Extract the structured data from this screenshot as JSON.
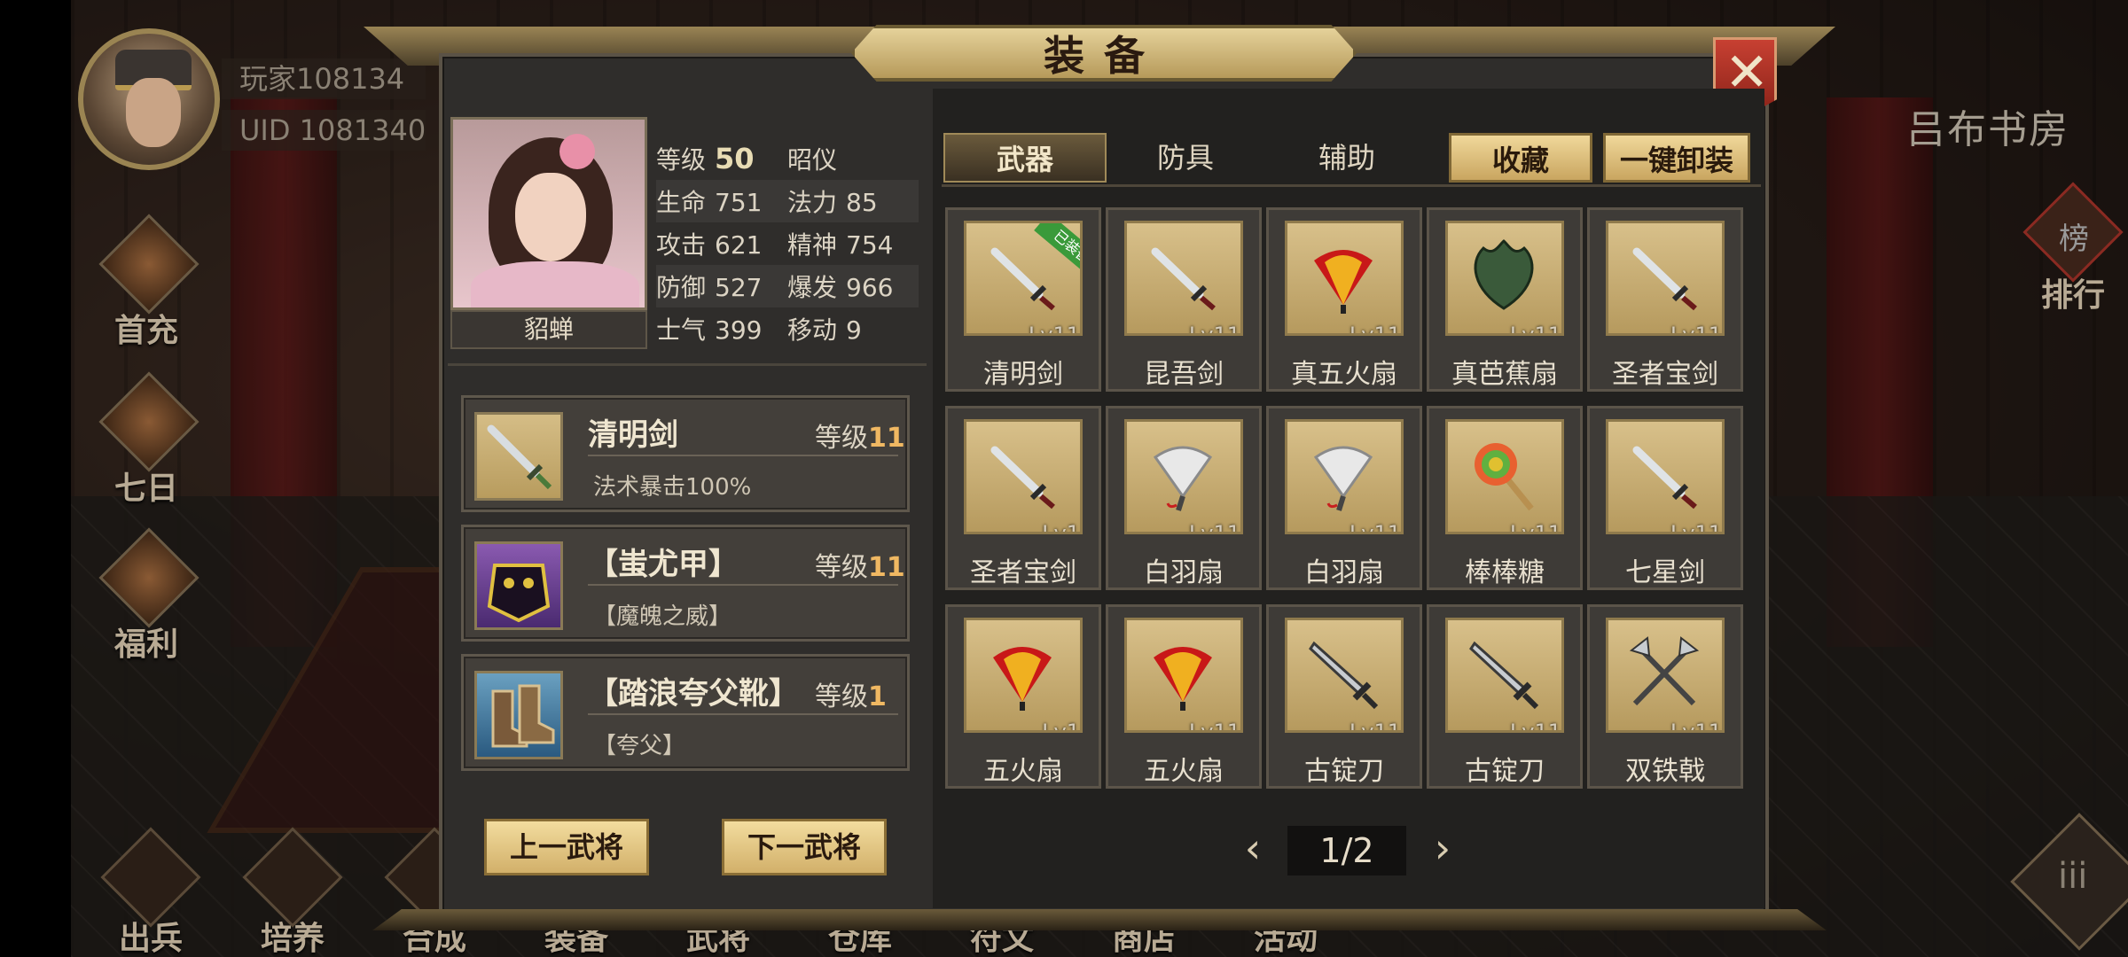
{
  "hud": {
    "player_name": "玩家108134",
    "player_uid": "UID  1081340",
    "room_title": "吕布书房",
    "side_buttons": [
      {
        "label": "首充",
        "icon": "gift-box-icon"
      },
      {
        "label": "七日",
        "icon": "scroll-icon"
      },
      {
        "label": "福利",
        "icon": "treasure-icon"
      }
    ],
    "rank_label": "排行",
    "rank_icon_text": "榜",
    "bottom_nav": [
      {
        "label": "出兵",
        "icon": "drum-icon"
      },
      {
        "label": "培养",
        "icon": "spear-icon"
      },
      {
        "label": "合成",
        "icon": "anvil-icon"
      },
      {
        "label": "装备",
        "icon": "armor-icon"
      },
      {
        "label": "武将",
        "icon": "general-icon"
      },
      {
        "label": "仓库",
        "icon": "chest-icon"
      },
      {
        "label": "符文",
        "icon": "rune-icon"
      },
      {
        "label": "商店",
        "icon": "shop-icon"
      },
      {
        "label": "活动",
        "icon": "flag-icon"
      }
    ],
    "menu_icon": "iii"
  },
  "modal": {
    "title": "装备",
    "close_icon": "✕"
  },
  "hero": {
    "name": "貂蝉",
    "level_label": "等级",
    "level": "50",
    "rank": "昭仪",
    "stats": [
      {
        "l1": "生命",
        "v1": "751",
        "l2": "法力",
        "v2": "85"
      },
      {
        "l1": "攻击",
        "v1": "621",
        "l2": "精神",
        "v2": "754"
      },
      {
        "l1": "防御",
        "v1": "527",
        "l2": "爆发",
        "v2": "966"
      },
      {
        "l1": "士气",
        "v1": "399",
        "l2": "移动",
        "v2": "9"
      }
    ]
  },
  "equipped": [
    {
      "name": "清明剑",
      "level_label": "等级",
      "level": "11",
      "desc": "法术暴击100%",
      "icon": "sword-icon"
    },
    {
      "name": "【蚩尤甲】",
      "level_label": "等级",
      "level": "11",
      "desc": "【魔魄之威】",
      "icon": "demon-armor-icon"
    },
    {
      "name": "【踏浪夸父靴】",
      "level_label": "等级",
      "level": "1",
      "desc": "【夸父】",
      "icon": "boots-icon"
    }
  ],
  "buttons": {
    "prev_hero": "上一武将",
    "next_hero": "下一武将"
  },
  "tabs": {
    "weapon": "武器",
    "armor": "防具",
    "assist": "辅助",
    "favorite": "收藏",
    "unequip_all": "一键卸装"
  },
  "badge_equipped": "已装备",
  "items": [
    {
      "name": "清明剑",
      "lv": "Lv11",
      "icon": "sword-icon",
      "equipped": true
    },
    {
      "name": "昆吾剑",
      "lv": "Lv11",
      "icon": "sword-icon",
      "equipped": false
    },
    {
      "name": "真五火扇",
      "lv": "Lv11",
      "icon": "fire-fan-icon",
      "equipped": false
    },
    {
      "name": "真芭蕉扇",
      "lv": "Lv11",
      "icon": "leaf-fan-icon",
      "equipped": false
    },
    {
      "name": "圣者宝剑",
      "lv": "Lv11",
      "icon": "sword-icon",
      "equipped": false
    },
    {
      "name": "圣者宝剑",
      "lv": "Lv1",
      "icon": "sword-icon",
      "equipped": false
    },
    {
      "name": "白羽扇",
      "lv": "Lv11",
      "icon": "feather-fan-icon",
      "equipped": false
    },
    {
      "name": "白羽扇",
      "lv": "Lv11",
      "icon": "feather-fan-icon",
      "equipped": false
    },
    {
      "name": "棒棒糖",
      "lv": "Lv11",
      "icon": "lollipop-icon",
      "equipped": false
    },
    {
      "name": "七星剑",
      "lv": "Lv11",
      "icon": "sword-icon",
      "equipped": false
    },
    {
      "name": "五火扇",
      "lv": "Lv1",
      "icon": "fire-fan-icon",
      "equipped": false
    },
    {
      "name": "五火扇",
      "lv": "Lv11",
      "icon": "fire-fan-icon",
      "equipped": false
    },
    {
      "name": "古锭刀",
      "lv": "Lv11",
      "icon": "blade-icon",
      "equipped": false
    },
    {
      "name": "古锭刀",
      "lv": "Lv11",
      "icon": "blade-icon",
      "equipped": false
    },
    {
      "name": "双铁戟",
      "lv": "Lv11",
      "icon": "halberd-icon",
      "equipped": false
    }
  ],
  "pager": {
    "page": "1/2",
    "prev": "‹",
    "next": "›"
  }
}
